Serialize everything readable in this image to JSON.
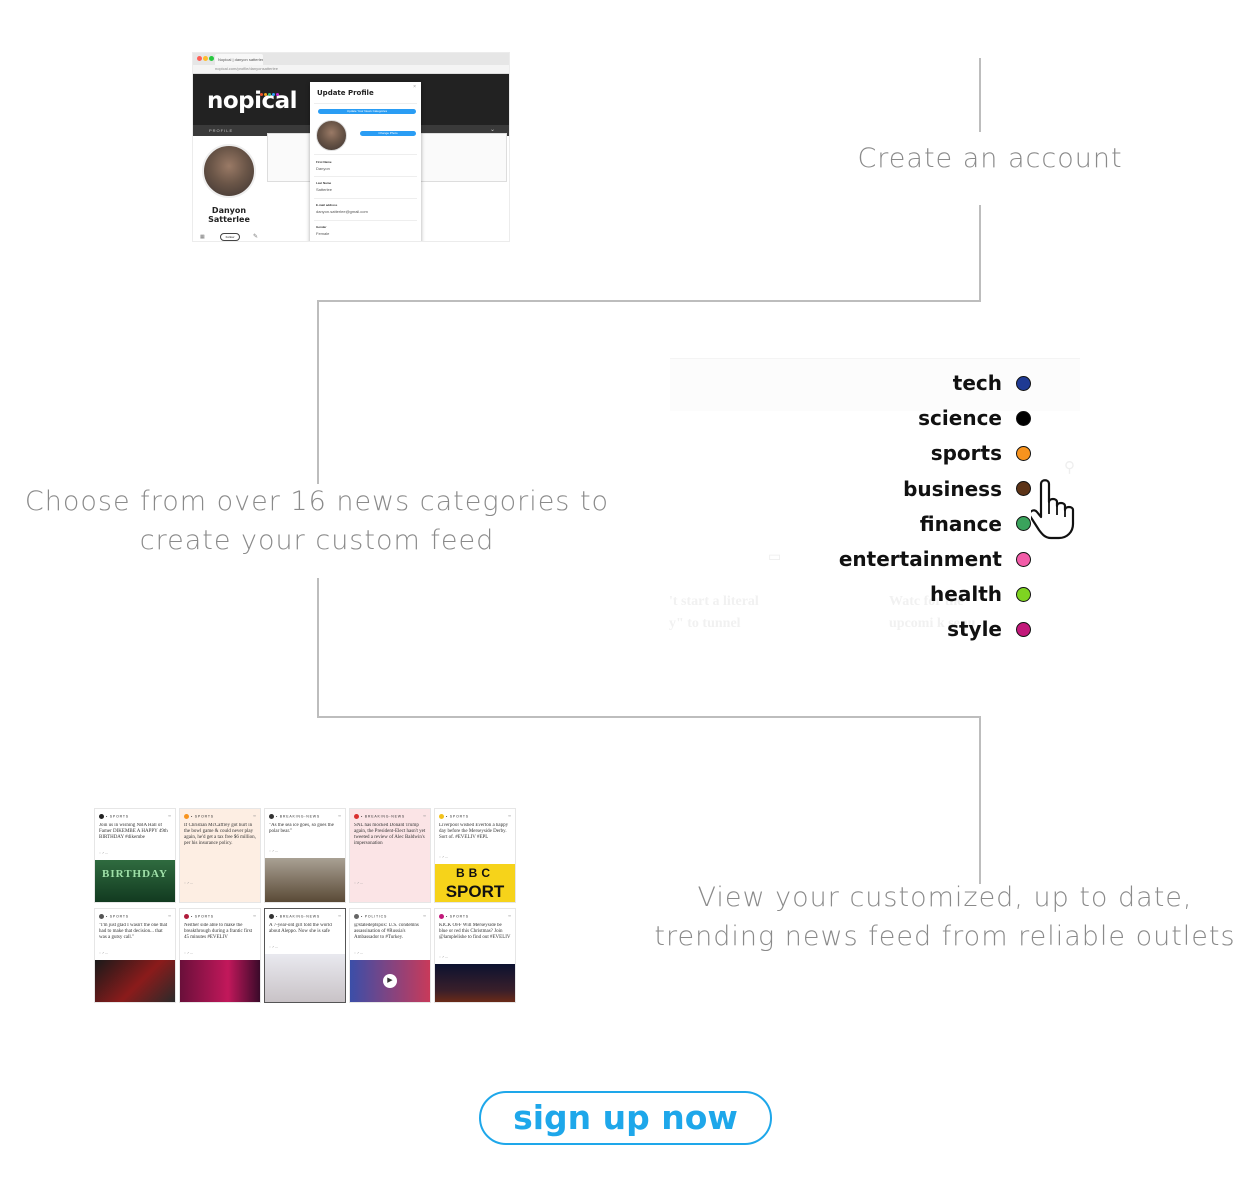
{
  "steps": {
    "create_account": "Create an account",
    "choose_line1": "Choose from over 16 news categories to",
    "choose_line2": "create your custom feed",
    "view_line1": "View your customized, up to date,",
    "view_line2": "trending news feed from reliable outlets"
  },
  "profile_screenshot": {
    "tab_title": "Nopical | danyon satterlee",
    "url": "nopical.com/profile/danyonsatterlee",
    "brand": "nopical",
    "brand_dot_colors": [
      "#f0522a",
      "#f2a41c",
      "#3cc47c",
      "#2a9df4",
      "#c42ad0"
    ],
    "nav_label": "PROFILE",
    "user_name": "Danyon Satterlee",
    "follow_label": "Follow",
    "modal": {
      "title": "Update Profile",
      "update_categories_button": "Update Your News Categories",
      "change_photo_button": "Change Photo",
      "first_name_label": "First Name",
      "first_name": "Danyon",
      "last_name_label": "Last Name",
      "last_name": "Satterlee",
      "email_label": "E-mail address",
      "email": "danyon.satterlee@gmail.com",
      "gender_label": "Gender",
      "gender": "Female"
    }
  },
  "categories": [
    {
      "name": "tech",
      "color": "#1f3a93"
    },
    {
      "name": "science",
      "color": "#000000"
    },
    {
      "name": "sports",
      "color": "#f7931e"
    },
    {
      "name": "business",
      "color": "#5c3317"
    },
    {
      "name": "finance",
      "color": "#3aa35c"
    },
    {
      "name": "entertainment",
      "color": "#f25ca8"
    },
    {
      "name": "health",
      "color": "#7ed321"
    },
    {
      "name": "style",
      "color": "#c2187a"
    }
  ],
  "background_fragments": {
    "left": "'t start a literal\ny\" to tunnel",
    "right": "Watc for the\nupcomi k sequ"
  },
  "feed_cards": [
    {
      "tag": "• SPORTS",
      "dot": "#222222",
      "text": "Join us in wishing NBA Hall of Famer DIKEMBE A HAPPY 49th BIRTHDAY #dikembe",
      "img": "birthday",
      "bg": "#ffffff"
    },
    {
      "tag": "• SPORTS",
      "dot": "#f7931e",
      "text": "If Christian McCaffrey got hurt in the bowl game & could never play again, he'd get a tax free $6 million, per his insurance policy.",
      "img": "",
      "bg": "#fdeee3"
    },
    {
      "tag": "• BREAKING-NEWS",
      "dot": "#333333",
      "text": "\"As the sea ice goes, so goes the polar bear.\"",
      "img": "bear",
      "bg": "#ffffff"
    },
    {
      "tag": "• BREAKING-NEWS",
      "dot": "#d93030",
      "text": "SNL has mocked Donald Trump again, the President-Elect hasn't yet tweeted a review of Alec Baldwin's impersonation",
      "img": "",
      "bg": "#fbe4e6"
    },
    {
      "tag": "• SPORTS",
      "dot": "#f2c21c",
      "text": "Liverpool wished Everton a happy day before the Merseyside Derby. Sort of. #EVELIV #EPL",
      "img": "bbc",
      "bg": "#ffffff"
    },
    {
      "tag": "• SPORTS",
      "dot": "#555555",
      "text": "\"I'm just glad I wasn't the one that had to make that decision... that was a gutsy call.\"",
      "img": "players",
      "bg": "#ffffff"
    },
    {
      "tag": "• SPORTS",
      "dot": "#b01c3c",
      "text": "Neither side able to make the breakthrough during a frantic first 45 minutes #EVELIV",
      "img": "premier",
      "bg": "#ffffff"
    },
    {
      "tag": "• BREAKING-NEWS",
      "dot": "#333333",
      "text": "A 7-year-old girl told the world about Aleppo. Now she is safe",
      "img": "girl",
      "bg": "#ffffff"
    },
    {
      "tag": "• POLITICS",
      "dot": "#666666",
      "text": "@statedeptspox: U.S. condemns assassination of #Russia's Ambassador to #Turkey.",
      "img": "video",
      "bg": "#ffffff"
    },
    {
      "tag": "• SPORTS",
      "dot": "#c2187a",
      "text": "KICK OFF Will Merseyside be blue or red this Christmas? Join @lamplelishe to find out #EVELIV",
      "img": "night",
      "bg": "#ffffff"
    }
  ],
  "feed_image_text": {
    "birthday": "BIRTHDAY",
    "bbc_top": "BBC",
    "bbc_bottom": "SPORT"
  },
  "cta": {
    "label": "sign up now",
    "color": "#1ea7ea"
  }
}
